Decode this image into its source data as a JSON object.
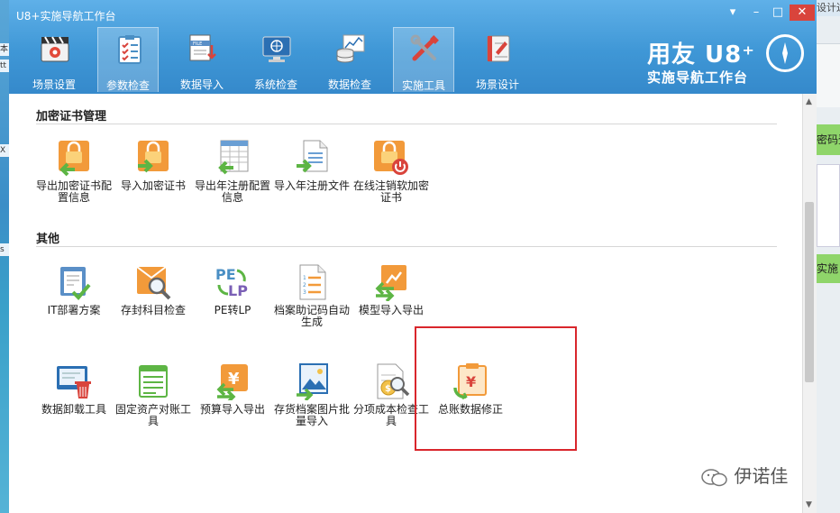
{
  "window": {
    "title": "U8+实施导航工作台",
    "controls": [
      "▾",
      "–",
      "□",
      "✕"
    ]
  },
  "tabs": [
    {
      "label": "场景设置",
      "icon": "clapperboard-icon",
      "active": false
    },
    {
      "label": "参数检查",
      "icon": "checklist-icon",
      "active": true
    },
    {
      "label": "数据导入",
      "icon": "file-import-icon",
      "active": false
    },
    {
      "label": "系统检查",
      "icon": "monitor-icon",
      "active": false
    },
    {
      "label": "数据检查",
      "icon": "database-chart-icon",
      "active": false
    },
    {
      "label": "实施工具",
      "icon": "tools-icon",
      "active": true
    },
    {
      "label": "场景设计",
      "icon": "design-book-icon",
      "active": false
    }
  ],
  "brand": {
    "line1": "用友 U8⁺",
    "line2": "实施导航工作台"
  },
  "sections": [
    {
      "title": "加密证书管理",
      "tools": [
        {
          "label": "导出加密证书配置信息",
          "icon": "export-certificate-icon"
        },
        {
          "label": "导入加密证书",
          "icon": "import-certificate-icon"
        },
        {
          "label": "导出年注册配置信息",
          "icon": "export-registration-icon"
        },
        {
          "label": "导入年注册文件",
          "icon": "import-registration-file-icon"
        },
        {
          "label": "在线注销软加密证书",
          "icon": "revoke-certificate-icon"
        }
      ]
    },
    {
      "title": "其他",
      "tools": [
        {
          "label": "IT部署方案",
          "icon": "it-deploy-icon"
        },
        {
          "label": "存封科目检查",
          "icon": "account-check-icon"
        },
        {
          "label": "PE转LP",
          "icon": "pe-to-lp-icon"
        },
        {
          "label": "档案助记码自动生成",
          "icon": "mnemonic-code-icon"
        },
        {
          "label": "模型导入导出",
          "icon": "model-import-export-icon"
        },
        {
          "label": "数据卸载工具",
          "icon": "data-unload-icon"
        },
        {
          "label": "固定资产对账工具",
          "icon": "fixed-asset-icon"
        },
        {
          "label": "预算导入导出",
          "icon": "budget-icon"
        },
        {
          "label": "存货档案图片批量导入",
          "icon": "inventory-image-icon"
        },
        {
          "label": "分项成本检查工具",
          "icon": "cost-check-icon"
        },
        {
          "label": "总账数据修正",
          "icon": "ledger-fix-icon"
        }
      ]
    }
  ],
  "watermark": {
    "text": "伊诺佳"
  },
  "desktop_right": {
    "t1": "设计达助工具",
    "t2": "密码登",
    "t3": "实施"
  },
  "colors": {
    "titlebar": "#3f97d6",
    "highlight": "#d9262c",
    "orange": "#f29a3a",
    "green": "#5db544"
  }
}
